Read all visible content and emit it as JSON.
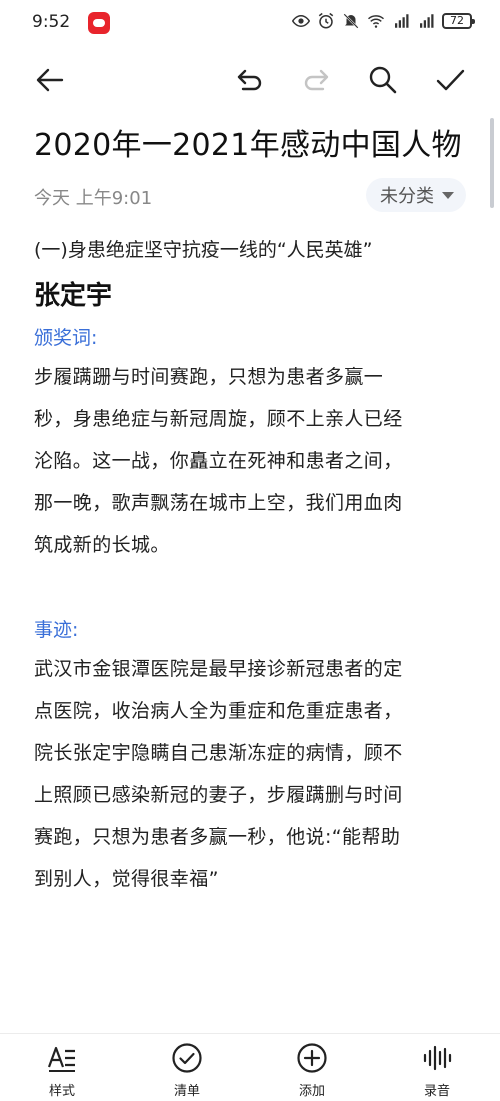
{
  "status_bar": {
    "time": "9:52",
    "battery": "72"
  },
  "toolbar": {
    "back_icon": "arrow-left-icon",
    "undo_icon": "undo-icon",
    "redo_icon": "redo-icon",
    "search_icon": "search-icon",
    "done_icon": "checkmark-icon"
  },
  "note": {
    "title": "2020年一2021年感动中国人物",
    "date": "今天 上午9:01",
    "category": "未分类",
    "subheading": "(一)身患绝症坚守抗疫一线的“人民英雄”",
    "person_name": "张定宇",
    "award_label": "颁奖词:",
    "award_lines": [
      "步履蹒跚与时间赛跑，只想为患者多赢一",
      "秒，身患绝症与新冠周旋，顾不上亲人已经",
      "沦陷。这一战，你矗立在死神和患者之间，",
      "那一晚，歌声飘荡在城市上空，我们用血肉",
      "筑成新的长城。"
    ],
    "deeds_label": "事迹:",
    "deeds_lines": [
      "武汉市金银潭医院是最早接诊新冠患者的定",
      "点医院，收治病人全为重症和危重症患者，",
      "院长张定宇隐瞒自己患渐冻症的病情，顾不",
      "上照顾已感染新冠的妻子，步履蹒删与时间",
      "赛跑，只想为患者多赢一秒，他说:“能帮助",
      "到别人，觉得很幸福”"
    ]
  },
  "bottom_bar": {
    "style_label": "样式",
    "checklist_label": "清单",
    "add_label": "添加",
    "record_label": "录音"
  },
  "colors": {
    "accent_blue": "#3a6fd8",
    "app_badge_red": "#e8242c"
  }
}
